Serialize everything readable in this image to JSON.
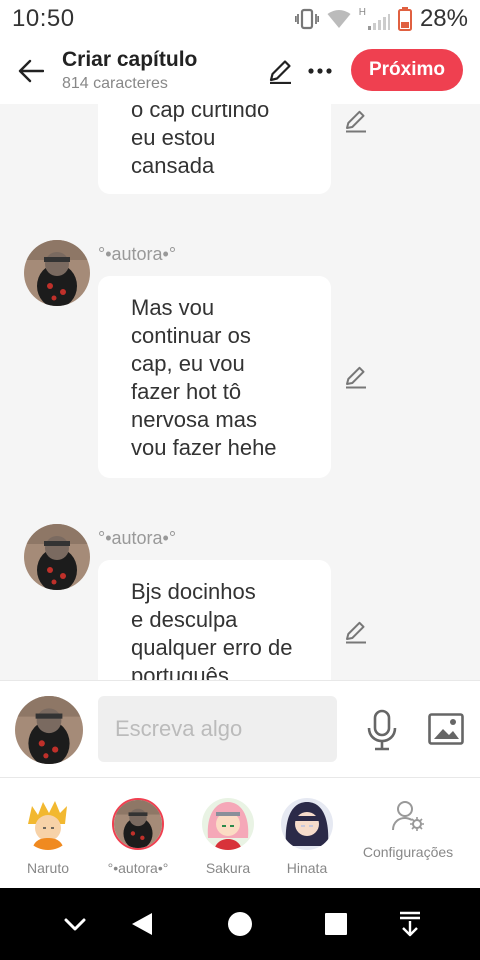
{
  "status_bar": {
    "time": "10:50",
    "network_label": "H",
    "battery": "28%"
  },
  "header": {
    "title": "Criar capítulo",
    "subtitle": "814 caracteres",
    "next_label": "Próximo",
    "icons": [
      "back-arrow-icon",
      "pencil-icon",
      "more-icon"
    ]
  },
  "chat": {
    "messages": [
      {
        "author": "",
        "text": "o cap curtindo\neu estou\ncansada"
      },
      {
        "author": "°•autora•°",
        "text": "Mas vou\ncontinuar os\ncap, eu vou\nfazer hot tô\nnervosa mas\nvou fazer hehe"
      },
      {
        "author": "°•autora•°",
        "text": "Bjs docinhos\ne desculpa\nqualquer erro de\nportuguês"
      }
    ]
  },
  "input": {
    "placeholder": "Escreva algo",
    "icons": [
      "microphone-icon",
      "image-icon"
    ]
  },
  "characters": [
    {
      "name": "Naruto"
    },
    {
      "name": "°•autora•°"
    },
    {
      "name": "Sakura"
    },
    {
      "name": "Hinata"
    }
  ],
  "settings": {
    "label": "Configurações"
  },
  "colors": {
    "accent": "#ef4050",
    "chat_background": "#f5f5f5",
    "bubble": "#ffffff",
    "muted_text": "#888888"
  }
}
